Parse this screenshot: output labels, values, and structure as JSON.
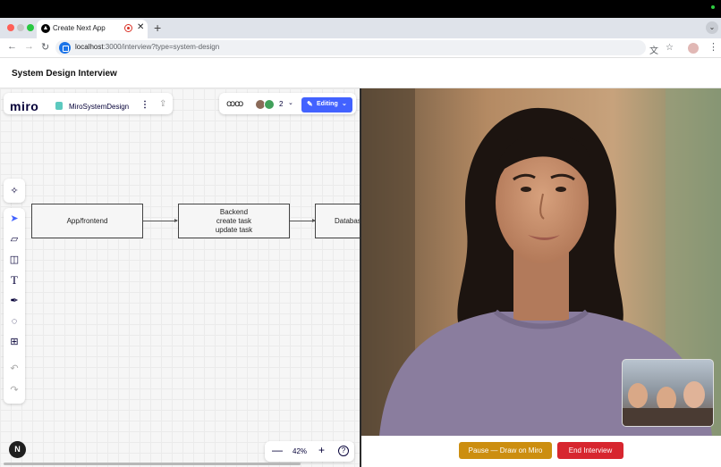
{
  "browser": {
    "tab_title": "Create Next App",
    "tab_favicon": "▲",
    "url_host": "localhost",
    "url_rest": ":3000/interview?type=system-design"
  },
  "page": {
    "title": "System Design Interview"
  },
  "miro": {
    "logo": "miro",
    "board_name": "MiroSystemDesign",
    "collab_logo": "ꝏꝏ",
    "collaborator_count": "2",
    "editing_label": "Editing",
    "zoom_level": "42%",
    "user_initial": "N",
    "nodes": {
      "frontend": "App/frontend",
      "backend_line1": "Backend",
      "backend_line2": "create task",
      "backend_line3": "update task",
      "database": "Databas"
    }
  },
  "controls": {
    "pause_label": "Pause — Draw on Miro",
    "end_label": "End Interview"
  },
  "colors": {
    "editing_blue": "#4262ff",
    "pause_amber": "#cc8e10",
    "end_red": "#d7262f"
  }
}
